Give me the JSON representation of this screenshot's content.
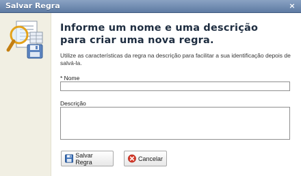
{
  "window": {
    "title": "Salvar Regra",
    "close_glyph": "×"
  },
  "sidebar": {
    "icon": "magnifier-document-save-icon"
  },
  "main": {
    "heading": "Informe um nome e uma descrição para criar uma nova regra.",
    "info": "Utilize as características da regra na descrição para facilitar a sua identificação depois de salvá-la.",
    "name_label": "* Nome",
    "name_value": "",
    "description_label": "Descrição",
    "description_value": ""
  },
  "buttons": {
    "save_label": "Salvar Regra",
    "save_icon": "floppy-disk-icon",
    "cancel_label": "Cancelar",
    "cancel_icon": "cancel-circle-icon"
  },
  "colors": {
    "titlebar": "#5e7ba3",
    "sidebar_bg": "#f1efe3",
    "heading": "#1e2d40",
    "cancel_icon": "#d93b2b",
    "save_icon": "#3b6fb6"
  }
}
